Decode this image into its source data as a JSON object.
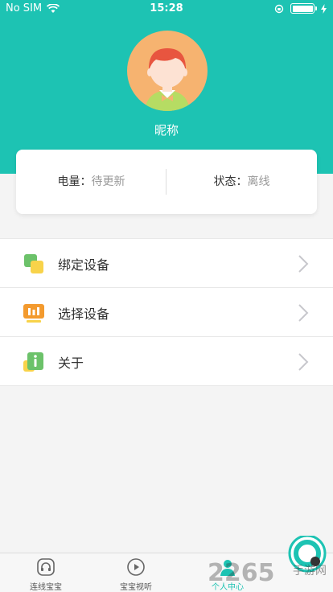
{
  "status_bar": {
    "carrier": "No SIM",
    "time": "15:28"
  },
  "profile": {
    "nickname": "昵称"
  },
  "info_card": {
    "battery_key": "电量：",
    "battery_value": "待更新",
    "status_key": "状态：",
    "status_value": "离线"
  },
  "menu": [
    {
      "label": "绑定设备",
      "icon": "bind-device-icon"
    },
    {
      "label": "选择设备",
      "icon": "select-device-icon"
    },
    {
      "label": "关于",
      "icon": "about-icon"
    }
  ],
  "tabs": [
    {
      "label": "连线宝宝",
      "icon": "connect-icon",
      "active": false
    },
    {
      "label": "宝宝视听",
      "icon": "play-icon",
      "active": false
    },
    {
      "label": "个人中心",
      "icon": "profile-icon",
      "active": true
    }
  ],
  "watermark": {
    "text": "2265",
    "suffix": "手游网"
  },
  "colors": {
    "accent": "#1dc3b3",
    "avatar_bg": "#f6b370"
  }
}
